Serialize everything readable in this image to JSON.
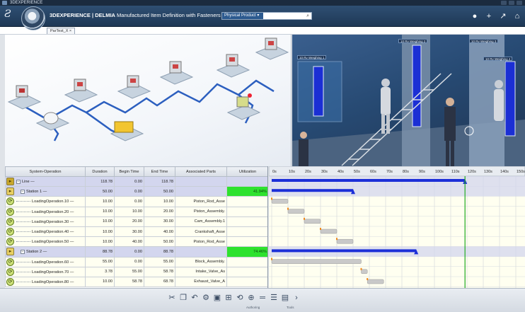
{
  "window": {
    "title": "3DEXPERIENCE"
  },
  "topbar": {
    "brand_prefix": "3DEXPERIENCE | DELMIA",
    "title_rest": "Manufactured Item Definition with Fasteners",
    "search_scope": "Physical Product",
    "search_value": "",
    "search_placeholder": ""
  },
  "tab": {
    "label": "ParTest_X",
    "close": "×"
  },
  "scene_right": {
    "chips": [
      "10 Rv Weighing 1",
      "10 Rv Weighing 2",
      "10 Rv Weighing 3",
      "10 Rv Weighing 4"
    ]
  },
  "table": {
    "columns": [
      "System-Operation",
      "Duration",
      "Begin Time",
      "End Time",
      "Associated Parts",
      "Utilization"
    ],
    "rows": [
      {
        "kind": "line",
        "name": "Line —",
        "duration": "118.78",
        "begin": "0.00",
        "end": "118.78",
        "parts": "",
        "util": ""
      },
      {
        "kind": "station",
        "name": "Station 1 —",
        "duration": "50.00",
        "begin": "0.00",
        "end": "50.00",
        "parts": "",
        "util": "41.94%"
      },
      {
        "kind": "op",
        "name": "LoadingOperation.10 —",
        "duration": "10.00",
        "begin": "0.00",
        "end": "10.00",
        "parts": "Piston_Rod_Asse",
        "util": ""
      },
      {
        "kind": "op",
        "name": "LoadingOperation.20 —",
        "duration": "10.00",
        "begin": "10.00",
        "end": "20.00",
        "parts": "Piston_Assembly.",
        "util": ""
      },
      {
        "kind": "op",
        "name": "LoadingOperation.30 —",
        "duration": "10.00",
        "begin": "20.00",
        "end": "30.00",
        "parts": "Cam_Assembly.1",
        "util": ""
      },
      {
        "kind": "op",
        "name": "LoadingOperation.40 —",
        "duration": "10.00",
        "begin": "30.00",
        "end": "40.00",
        "parts": "Crankshaft_Asse",
        "util": ""
      },
      {
        "kind": "op",
        "name": "LoadingOperation.50 —",
        "duration": "10.00",
        "begin": "40.00",
        "end": "50.00",
        "parts": "Piston_Rod_Asse",
        "util": ""
      },
      {
        "kind": "station",
        "name": "Station 2 —",
        "duration": "88.78",
        "begin": "0.00",
        "end": "88.78",
        "parts": "",
        "util": "74.46%"
      },
      {
        "kind": "op",
        "name": "LoadingOperation.60 —",
        "duration": "55.00",
        "begin": "0.00",
        "end": "55.00",
        "parts": "Block_Assembly.",
        "util": ""
      },
      {
        "kind": "op",
        "name": "LoadingOperation.70 —",
        "duration": "3.78",
        "begin": "55.00",
        "end": "58.78",
        "parts": "Intake_Valve_As",
        "util": ""
      },
      {
        "kind": "op",
        "name": "LoadingOperation.80 —",
        "duration": "10.00",
        "begin": "58.78",
        "end": "68.78",
        "parts": "Exhaust_Valve_A",
        "util": ""
      }
    ]
  },
  "gantt": {
    "ticks": [
      "0s",
      "10s",
      "20s",
      "30s",
      "40s",
      "50s",
      "60s",
      "70s",
      "80s",
      "90s",
      "100s",
      "110s",
      "120s",
      "130s",
      "140s",
      "150s"
    ]
  },
  "bottombar": {
    "tools": [
      "cut-icon",
      "copy-icon",
      "undo-icon",
      "process-icon",
      "resource-icon",
      "analysis-icon",
      "simulation-icon",
      "tools-icon",
      "line-icon",
      "gantt-icon",
      "report-icon",
      "more-icon"
    ],
    "labels": [
      "Authoring",
      "Tools"
    ]
  }
}
